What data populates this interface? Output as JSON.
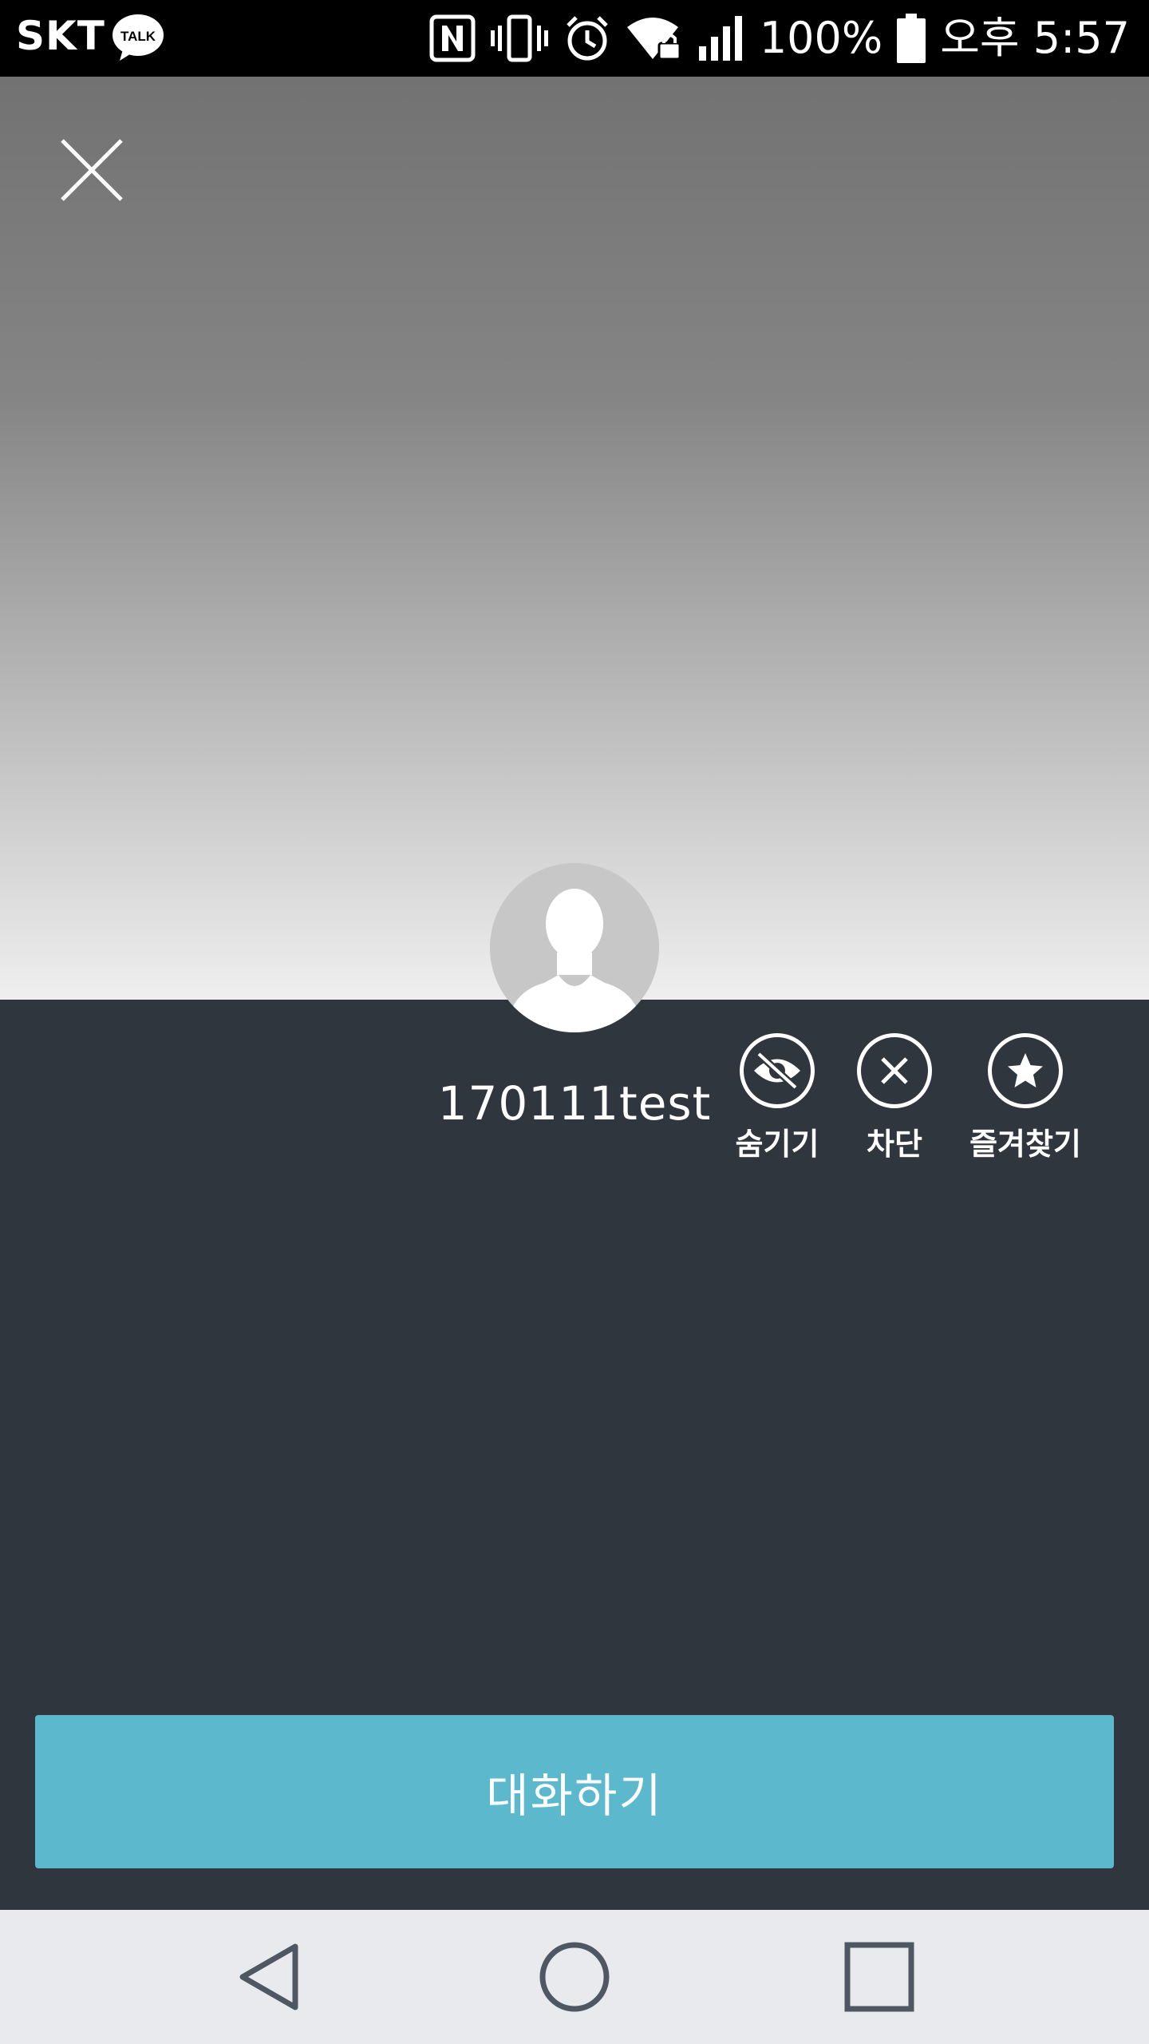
{
  "status_bar": {
    "carrier": "SKT",
    "talk_badge": "TALK",
    "battery": "100%",
    "time": "오후 5:57",
    "icons": [
      "kakaotalk-icon",
      "nfc-icon",
      "vibrate-icon",
      "alarm-icon",
      "wifi-lock-icon",
      "signal-icon",
      "battery-icon"
    ]
  },
  "profile": {
    "name": "170111test"
  },
  "actions": [
    {
      "label": "숨기기",
      "icon": "hide-icon"
    },
    {
      "label": "차단",
      "icon": "block-icon"
    },
    {
      "label": "즐겨찾기",
      "icon": "star-icon"
    }
  ],
  "chat_button": {
    "label": "대화하기"
  },
  "colors": {
    "accent": "#5bb8cd",
    "background": "#30363e",
    "nav_bg": "#e8eaee"
  }
}
